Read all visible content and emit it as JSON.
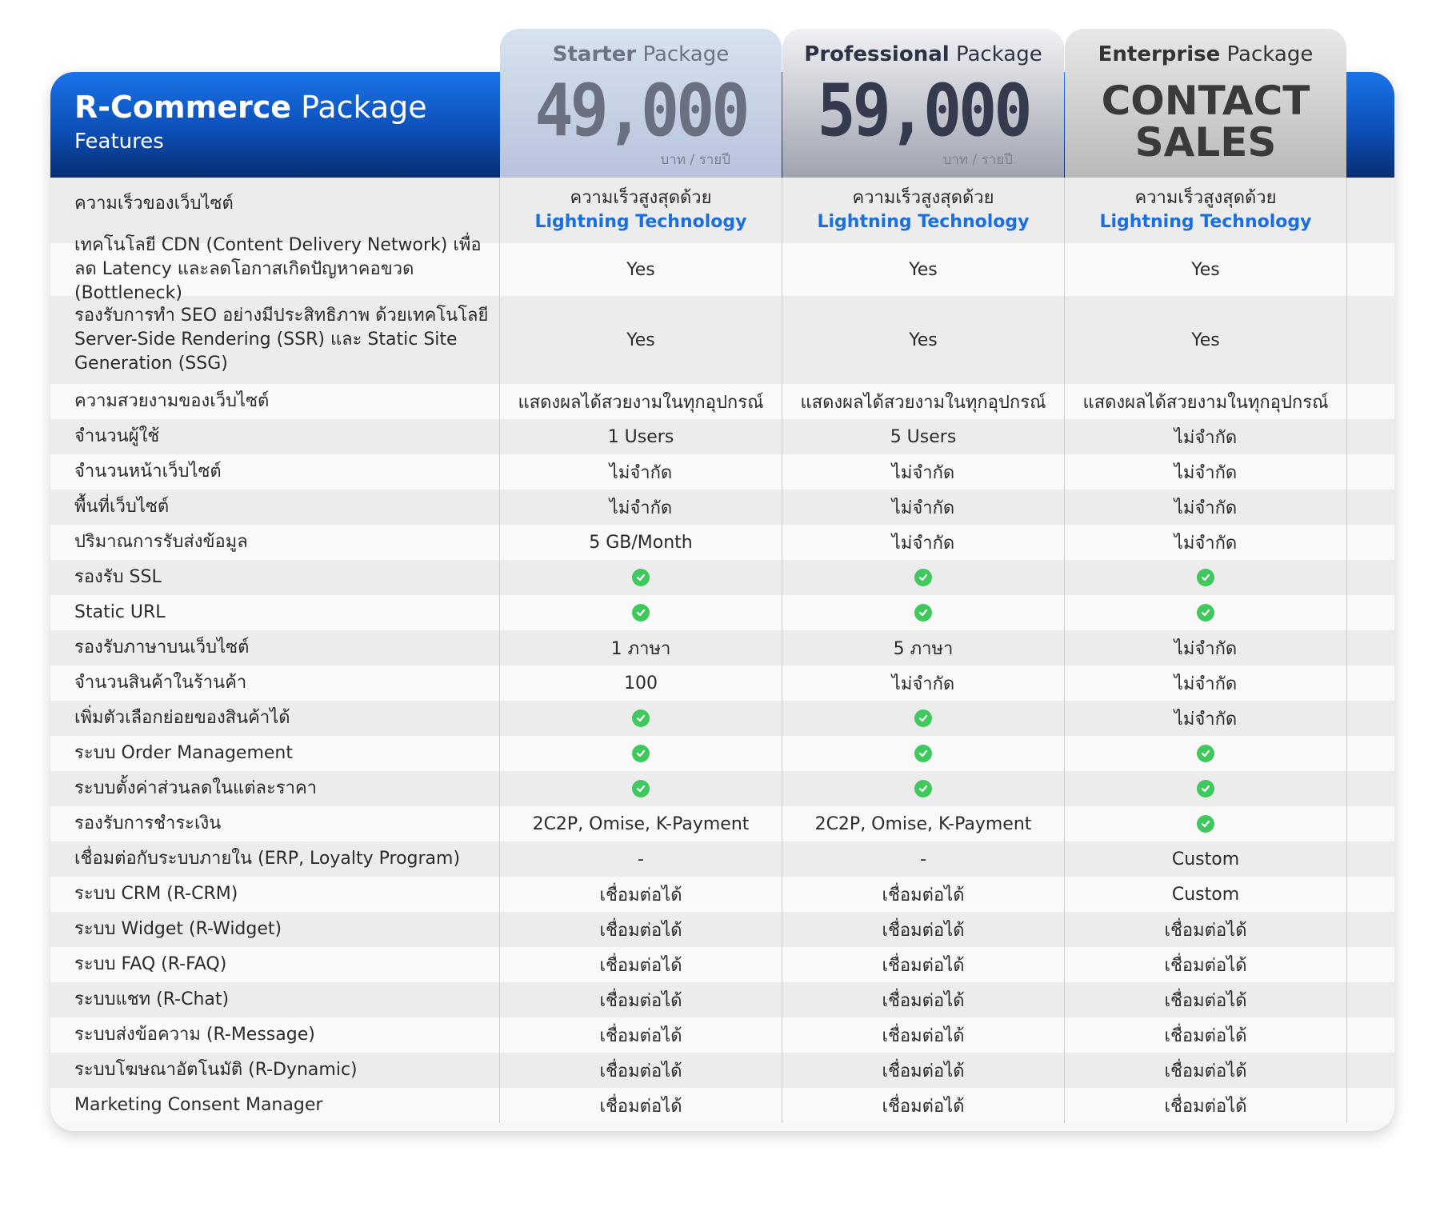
{
  "header": {
    "brand_bold": "R-Commerce",
    "brand_light": "Package",
    "subtitle": "Features"
  },
  "packages": [
    {
      "name_bold": "Starter",
      "name_light": "Package",
      "price": "49,000",
      "unit": "บาท / รายปี"
    },
    {
      "name_bold": "Professional",
      "name_light": "Package",
      "price": "59,000",
      "unit": "บาท / รายปี"
    },
    {
      "name_bold": "Enterprise",
      "name_light": "Package",
      "contact_line1": "CONTACT",
      "contact_line2": "SALES"
    }
  ],
  "speed": {
    "line1": "ความเร็วสูงสุดด้วย",
    "line2": "Lightning Technology"
  },
  "icons": {
    "check": "check-circle-icon",
    "check_color": "#3fc85d"
  },
  "colors": {
    "brand_blue": "#1a73ea",
    "link_blue": "#1a6fe0"
  },
  "rows": [
    {
      "feature": "ความเร็วของเว็บไซต์",
      "values": [
        "",
        "",
        ""
      ]
    },
    {
      "feature": "เทคโนโลยี CDN (Content Delivery Network) เพื่อลด Latency และลดโอกาสเกิดปัญหาคอขวด (Bottleneck)",
      "values": [
        "Yes",
        "Yes",
        "Yes"
      ]
    },
    {
      "feature": "รองรับการทำ SEO อย่างมีประสิทธิภาพ ด้วยเทคโนโลยี Server-Side Rendering (SSR) และ Static Site Generation (SSG)",
      "values": [
        "Yes",
        "Yes",
        "Yes"
      ]
    },
    {
      "feature": "ความสวยงามของเว็บไซต์",
      "values": [
        "แสดงผลได้สวยงามในทุกอุปกรณ์",
        "แสดงผลได้สวยงามในทุกอุปกรณ์",
        "แสดงผลได้สวยงามในทุกอุปกรณ์"
      ]
    },
    {
      "feature": "จำนวนผู้ใช้",
      "values": [
        "1 Users",
        "5 Users",
        "ไม่จำกัด"
      ]
    },
    {
      "feature": "จำนวนหน้าเว็บไซต์",
      "values": [
        "ไม่จำกัด",
        "ไม่จำกัด",
        "ไม่จำกัด"
      ]
    },
    {
      "feature": "พื้นที่เว็บไซต์",
      "values": [
        "ไม่จำกัด",
        "ไม่จำกัด",
        "ไม่จำกัด"
      ]
    },
    {
      "feature": "ปริมาณการรับส่งข้อมูล",
      "values": [
        "5 GB/Month",
        "ไม่จำกัด",
        "ไม่จำกัด"
      ]
    },
    {
      "feature": "รองรับ SSL",
      "values": [
        "check",
        "check",
        "check"
      ]
    },
    {
      "feature": "Static URL",
      "values": [
        "check",
        "check",
        "check"
      ]
    },
    {
      "feature": "รองรับภาษาบนเว็บไซต์",
      "values": [
        "1 ภาษา",
        "5 ภาษา",
        "ไม่จำกัด"
      ]
    },
    {
      "feature": "จำนวนสินค้าในร้านค้า",
      "values": [
        "100",
        "ไม่จำกัด",
        "ไม่จำกัด"
      ]
    },
    {
      "feature": "เพิ่มตัวเลือกย่อยของสินค้าได้",
      "values": [
        "check",
        "check",
        "ไม่จำกัด"
      ]
    },
    {
      "feature": "ระบบ Order Management",
      "values": [
        "check",
        "check",
        "check"
      ]
    },
    {
      "feature": "ระบบตั้งค่าส่วนลดในแต่ละราคา",
      "values": [
        "check",
        "check",
        "check"
      ]
    },
    {
      "feature": "รองรับการชำระเงิน",
      "values": [
        "2C2P, Omise, K-Payment",
        "2C2P, Omise, K-Payment",
        "check"
      ]
    },
    {
      "feature": "เชื่อมต่อกับระบบภายใน (ERP, Loyalty Program)",
      "values": [
        "-",
        "-",
        "Custom"
      ]
    },
    {
      "feature": "ระบบ CRM (R-CRM)",
      "values": [
        "เชื่อมต่อได้",
        "เชื่อมต่อได้",
        "Custom"
      ]
    },
    {
      "feature": "ระบบ Widget (R-Widget)",
      "values": [
        "เชื่อมต่อได้",
        "เชื่อมต่อได้",
        "เชื่อมต่อได้"
      ]
    },
    {
      "feature": "ระบบ FAQ (R-FAQ)",
      "values": [
        "เชื่อมต่อได้",
        "เชื่อมต่อได้",
        "เชื่อมต่อได้"
      ]
    },
    {
      "feature": "ระบบแชท (R-Chat)",
      "values": [
        "เชื่อมต่อได้",
        "เชื่อมต่อได้",
        "เชื่อมต่อได้"
      ]
    },
    {
      "feature": "ระบบส่งข้อความ (R-Message)",
      "values": [
        "เชื่อมต่อได้",
        "เชื่อมต่อได้",
        "เชื่อมต่อได้"
      ]
    },
    {
      "feature": "ระบบโฆษณาอัตโนมัติ (R-Dynamic)",
      "values": [
        "เชื่อมต่อได้",
        "เชื่อมต่อได้",
        "เชื่อมต่อได้"
      ]
    },
    {
      "feature": "Marketing Consent Manager",
      "values": [
        "เชื่อมต่อได้",
        "เชื่อมต่อได้",
        "เชื่อมต่อได้"
      ]
    }
  ]
}
